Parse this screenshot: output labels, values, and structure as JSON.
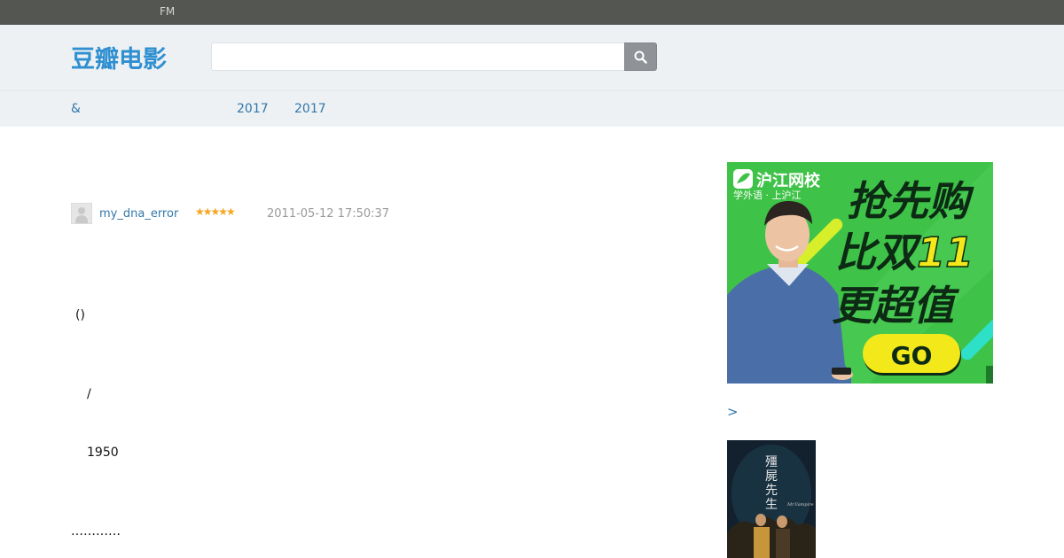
{
  "topbar": {
    "fm_label": "FM"
  },
  "header": {
    "logo_text": "豆瓣电影",
    "search_placeholder": ""
  },
  "subnav": {
    "items": [
      "&",
      "2017",
      "2017"
    ]
  },
  "review": {
    "username": "my_dna_error",
    "rating_stars": "★★★★★",
    "rating_value": 5,
    "timestamp": "2011-05-12 17:50:37",
    "paragraphs": [
      "()",
      "/",
      "1950",
      "…………"
    ]
  },
  "ad": {
    "brand_name": "沪江网校",
    "brand_tagline": "学外语 · 上沪江",
    "headline_line1": "抢先购",
    "headline_line2_prefix": "比双",
    "headline_line2_number": "11",
    "headline_line3": "更超值",
    "cta_label": "GO",
    "colors": {
      "background": "#3fc248",
      "text_dark": "#0c2a14",
      "accent_yellow": "#f2e81a"
    }
  },
  "sidebar": {
    "more_link": ">"
  },
  "poster": {
    "title_chars": [
      "殭",
      "屍",
      "先",
      "生"
    ],
    "english_title": "Mr.Vampire"
  }
}
